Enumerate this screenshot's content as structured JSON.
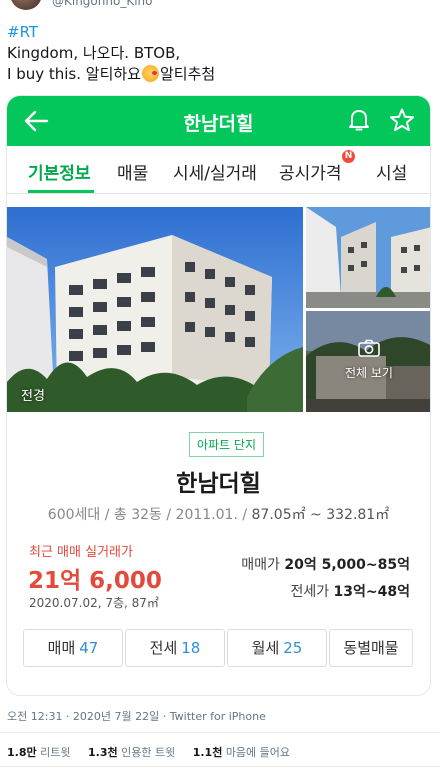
{
  "tweet": {
    "handle": "@Kingonno_Kino",
    "hashtag": "#RT",
    "line1": "Kingdom, 나오다. BTOB,",
    "line2a": "I buy this. 알티하요",
    "line2b": "알티추첨",
    "timestamp": "오전 12:31 · 2020년 7월 22일 · Twitter for iPhone",
    "stats": [
      {
        "count": "1.8만",
        "label": "리트윗"
      },
      {
        "count": "1.3천",
        "label": "인용한 트윗"
      },
      {
        "count": "1.1천",
        "label": "마음에 들어요"
      }
    ]
  },
  "app": {
    "title": "한남더힐",
    "accent": "#03c75a",
    "tabs": [
      "기본정보",
      "매물",
      "시세/실거래",
      "공시가격",
      "시설"
    ],
    "badge": "N",
    "photo_label": "전경",
    "view_all": "전체 보기",
    "complex_chip": "아파트 단지",
    "complex_name": "한남더힐",
    "complex_info": {
      "households": "600세대",
      "buildings": "총 32동",
      "built": "2011.01.",
      "area": "87.05㎡ ~ 332.81㎡"
    },
    "recent": {
      "label": "최근 매매 실거래가",
      "price": "21억 6,000",
      "meta": "2020.07.02, 7층, 87㎡"
    },
    "sale": {
      "label": "매매가",
      "value": "20억 5,000~85억"
    },
    "lease": {
      "label": "전세가",
      "value": "13억~48억"
    },
    "bottom_tabs": [
      {
        "label": "매매",
        "count": "47"
      },
      {
        "label": "전세",
        "count": "18"
      },
      {
        "label": "월세",
        "count": "25"
      },
      {
        "label": "동별매물",
        "count": ""
      }
    ],
    "icons": [
      "back-arrow-icon",
      "bell-icon",
      "star-icon",
      "camera-icon"
    ]
  }
}
